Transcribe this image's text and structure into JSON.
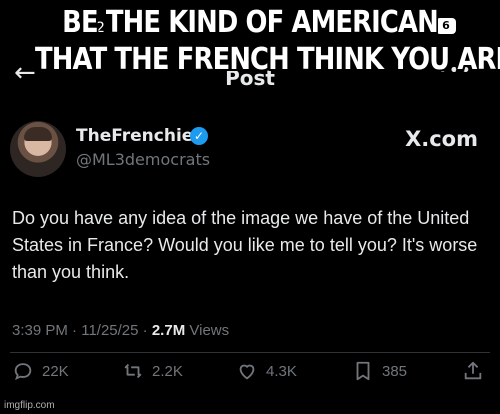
{
  "meme": {
    "caption_line1": "BE THE KIND OF AMERICAN",
    "caption_line2": "THAT THE FRENCH THINK YOU ARE",
    "watermark": "imgflip.com"
  },
  "status_bar": {
    "time_fragment": "2",
    "battery": "6"
  },
  "nav": {
    "back_icon": "back-arrow-icon",
    "title": "Post",
    "more_icon": "more-icon"
  },
  "author": {
    "name": "TheFrenchie",
    "handle": "@ML3democrats",
    "verified": true,
    "brand": "X.com"
  },
  "tweet": {
    "text": "Do you have any idea of the image we have of the United States in France? Would you like me to tell you? It's worse than you think.",
    "time": "3:39 PM",
    "date": "11/25/25",
    "views_count": "2.7M",
    "views_label": "Views"
  },
  "actions": {
    "replies": "22K",
    "reposts": "2.2K",
    "likes": "4.3K",
    "bookmarks": "385"
  },
  "colors": {
    "background": "#000000",
    "text": "#e7e9ea",
    "muted": "#71767b",
    "verified": "#1d9bf0"
  }
}
